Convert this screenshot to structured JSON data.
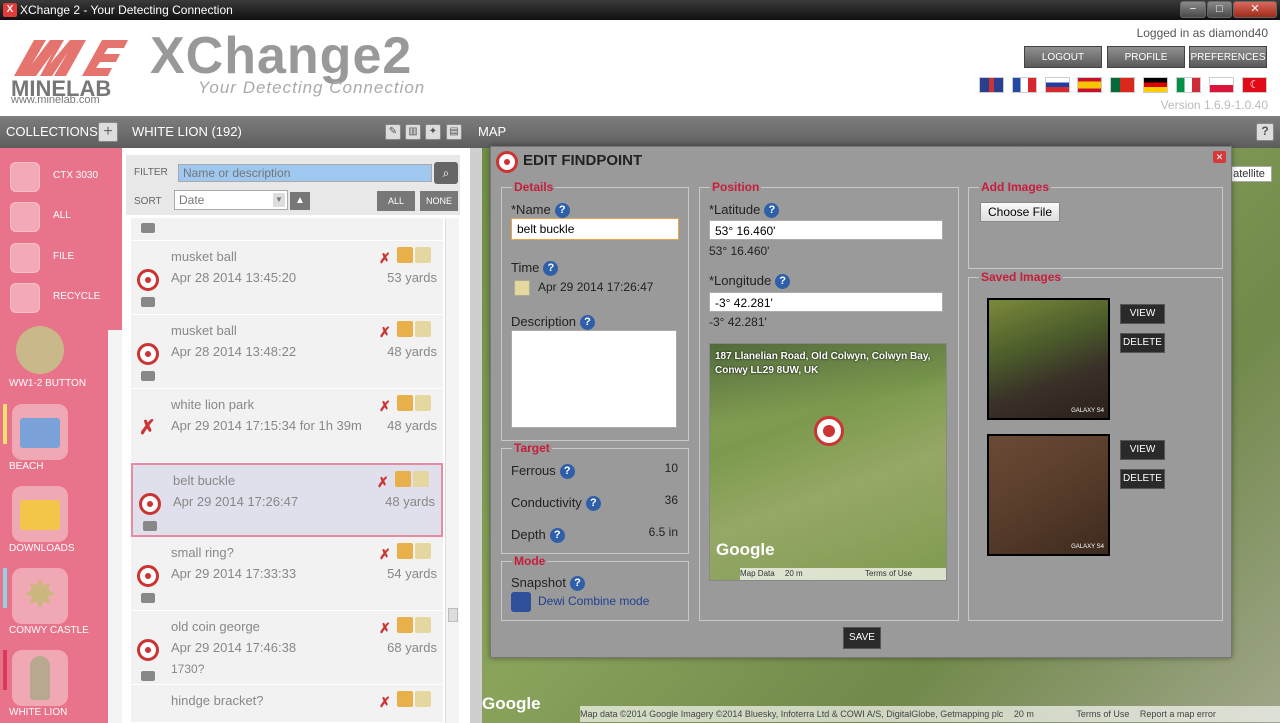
{
  "window": {
    "title": "XChange 2 - Your Detecting Connection",
    "min": "−",
    "max": "□",
    "close": "✕"
  },
  "header": {
    "brand": "MINELAB",
    "brand_url": "www.minelab.com",
    "product": "XChange2",
    "tagline": "Your Detecting Connection",
    "logged_in": "Logged in as diamond40",
    "buttons": {
      "logout": "LOGOUT",
      "profile": "PROFILE",
      "preferences": "PREFERENCES"
    },
    "version": "Version 1.6.9-1.0.40"
  },
  "toolbar": {
    "collections": "COLLECTIONS",
    "collection_name": "WHITE LION (192)",
    "map": "MAP"
  },
  "sidebar": {
    "items": [
      {
        "label": "CTX 3030"
      },
      {
        "label": "ALL"
      },
      {
        "label": "FILE"
      },
      {
        "label": "RECYCLE"
      }
    ],
    "collections": [
      {
        "label": "WW1-2 BUTTON",
        "bar": ""
      },
      {
        "label": "BEACH",
        "bar": "#f0e070"
      },
      {
        "label": "DOWNLOADS",
        "bar": ""
      },
      {
        "label": "CONWY CASTLE",
        "bar": "#8fd4e6"
      },
      {
        "label": "WHITE LION",
        "bar": "#d83a5a"
      }
    ]
  },
  "list": {
    "filter_label": "FILTER",
    "filter_placeholder": "Name or description",
    "sort_label": "SORT",
    "sort_value": "Date",
    "all_btn": "ALL",
    "none_btn": "NONE",
    "items": [
      {
        "name": "musket ball",
        "date": "Apr 28 2014 13:45:20",
        "duration": "",
        "yards": "53 yards",
        "extra": "",
        "type": "target"
      },
      {
        "name": "musket ball",
        "date": "Apr 28 2014 13:48:22",
        "duration": "",
        "yards": "48 yards",
        "extra": "",
        "type": "target"
      },
      {
        "name": "white lion park",
        "date": "Apr 29 2014 17:15:34",
        "duration": "for 1h 39m",
        "yards": "48 yards",
        "extra": "",
        "type": "trail"
      },
      {
        "name": "belt buckle",
        "date": "Apr 29 2014 17:26:47",
        "duration": "",
        "yards": "48 yards",
        "extra": "",
        "type": "target"
      },
      {
        "name": "small ring?",
        "date": "Apr 29 2014 17:33:33",
        "duration": "",
        "yards": "54 yards",
        "extra": "",
        "type": "target"
      },
      {
        "name": "old coin george",
        "date": "Apr 29 2014 17:46:38",
        "duration": "",
        "yards": "68 yards",
        "extra": "1730?",
        "type": "target"
      },
      {
        "name": "hindge bracket?",
        "date": "",
        "duration": "",
        "yards": "",
        "extra": "",
        "type": "target"
      }
    ]
  },
  "modal": {
    "title": "EDIT FINDPOINT",
    "details": {
      "heading": "Details",
      "name_label": "*Name",
      "name_value": "belt buckle",
      "time_label": "Time",
      "time_value": "Apr 29 2014 17:26:47",
      "desc_label": "Description",
      "desc_value": ""
    },
    "target": {
      "heading": "Target",
      "ferrous_label": "Ferrous",
      "ferrous_value": "10",
      "conductivity_label": "Conductivity",
      "conductivity_value": "36",
      "depth_label": "Depth",
      "depth_value": "6.5 in"
    },
    "mode": {
      "heading": "Mode",
      "snapshot_label": "Snapshot",
      "mode_name": "Dewi Combine mode"
    },
    "position": {
      "heading": "Position",
      "lat_label": "*Latitude",
      "lat_value": "53° 16.460'",
      "lat_display": "53° 16.460'",
      "lon_label": "*Longitude",
      "lon_value": "-3° 42.281'",
      "lon_display": "-3° 42.281'",
      "address": "187 Llanelian Road, Old Colwyn, Colwyn Bay, Conwy LL29 8UW, UK",
      "map_google": "Google",
      "map_data": "Map Data",
      "map_scale": "20 m",
      "map_terms": "Terms of Use"
    },
    "add_images": {
      "heading": "Add Images",
      "choose_file": "Choose File"
    },
    "saved_images": {
      "heading": "Saved Images",
      "view": "VIEW",
      "delete": "DELETE",
      "watermark": "GALAXY S4"
    },
    "save": "SAVE"
  },
  "map": {
    "satellite_btn": "atellite",
    "google": "Google",
    "footer": "Map data ©2014 Google Imagery ©2014 Bluesky, Infoterra Ltd & COWI A/S, DigitalGlobe, Getmapping plc",
    "scale": "20 m",
    "terms": "Terms of Use",
    "report": "Report a map error"
  }
}
